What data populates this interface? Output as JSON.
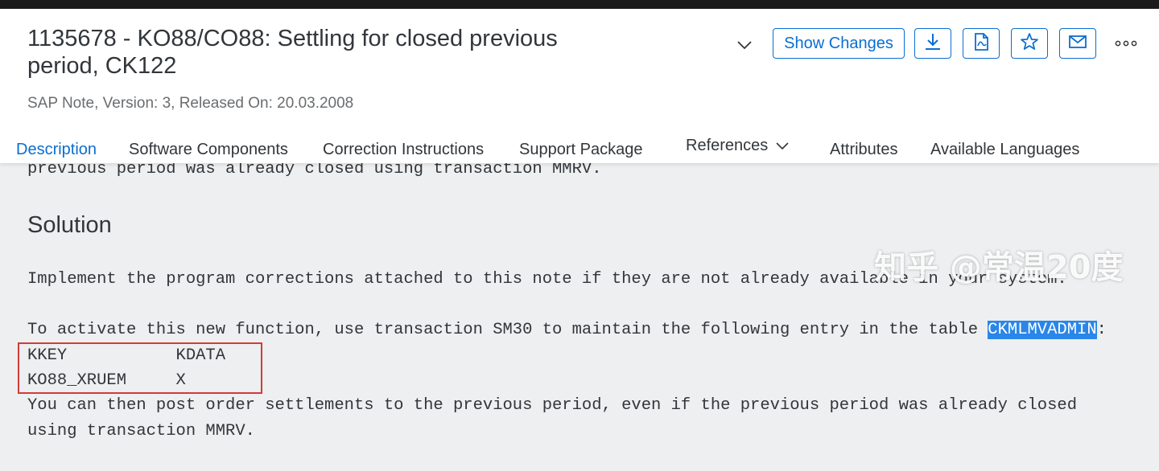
{
  "header": {
    "title": "1135678 - KO88/CO88: Settling for closed previous period, CK122",
    "subtitle": "SAP Note, Version: 3, Released On: 20.03.2008",
    "show_changes_label": "Show Changes",
    "icons": [
      "chevron-down-icon",
      "download-icon",
      "pdf-icon",
      "star-icon",
      "email-icon",
      "more-icon"
    ]
  },
  "tabs": [
    {
      "label": "Description",
      "active": true
    },
    {
      "label": "Software Components"
    },
    {
      "label": "Correction Instructions"
    },
    {
      "label": "Support Package"
    },
    {
      "label": "References"
    },
    {
      "label": "Attributes"
    },
    {
      "label": "Available Languages"
    }
  ],
  "content": {
    "line_top": "previous period was already closed using transaction MMRV.",
    "section_title": "Solution",
    "line_implement": "Implement the program corrections attached to this note if they are not already available in your system.",
    "line_activate_before": "To activate this new function, use transaction SM30 to maintain the following entry in the table ",
    "line_activate_highlight": "CKMLMVADMIN",
    "line_activate_after": ":",
    "table_header": "KKEY           KDATA",
    "table_row": "KO88_XRUEM     X",
    "line_post_1": "You can then post order settlements to the previous period, even if the previous period was already closed",
    "line_post_2": "using transaction MMRV."
  },
  "watermark": "知乎 @常温20度",
  "colors": {
    "accent": "#0a6ed1",
    "highlight": "#2a86e8",
    "box": "#d33a3a",
    "text": "#32363a",
    "background": "#edeff0"
  }
}
